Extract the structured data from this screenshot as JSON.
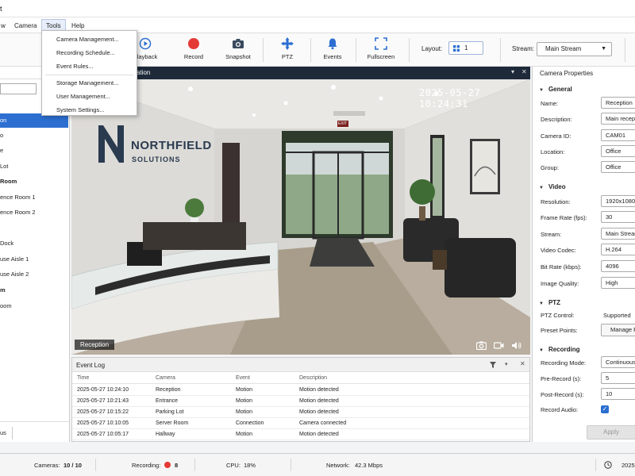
{
  "app": {
    "title_fragment": "t"
  },
  "menu": {
    "items": [
      "w",
      "Camera",
      "Tools",
      "Help"
    ],
    "tools_dropdown": {
      "group1": [
        "Camera Management...",
        "Recording Schedule...",
        "Event Rules..."
      ],
      "group2": [
        "Storage Management...",
        "User Management...",
        "System Settings..."
      ]
    }
  },
  "toolbar": {
    "playback": "Playback",
    "record": "Record",
    "snapshot": "Snapshot",
    "ptz": "PTZ",
    "events": "Events",
    "fullscreen": "Fullscreen",
    "layout_label": "Layout:",
    "layout_value": "1",
    "stream_label": "Stream:",
    "stream_value": "Main Stream"
  },
  "left_panel": {
    "header": "▾",
    "bottom_tab": "us",
    "tree": [
      {
        "label": "on",
        "type": "camera",
        "selected": true
      },
      {
        "label": "o",
        "type": "camera"
      },
      {
        "label": "e",
        "type": "camera"
      },
      {
        "label": " Lot",
        "type": "camera"
      },
      {
        "label": " Room",
        "type": "group"
      },
      {
        "label": "ence Room 1",
        "type": "camera"
      },
      {
        "label": "ence Room 2",
        "type": "camera"
      },
      {
        "label": "",
        "type": "group"
      },
      {
        "label": " Dock",
        "type": "camera"
      },
      {
        "label": "use Aisle 1",
        "type": "camera"
      },
      {
        "label": "use Aisle 2",
        "type": "camera"
      },
      {
        "label": "m",
        "type": "group"
      },
      {
        "label": "oom",
        "type": "camera"
      }
    ]
  },
  "video": {
    "header_title": "ation",
    "timestamp": "2025-05-27 10:24:31",
    "camera_label": "Reception",
    "logo_line1": "NORTHFIELD",
    "logo_line2": "SOLUTIONS",
    "exit_sign": "EXIT"
  },
  "event_log": {
    "title": "Event Log",
    "columns": [
      "Time",
      "Camera",
      "Event",
      "Description"
    ],
    "rows": [
      [
        "2025-05-27 10:24:10",
        "Reception",
        "Motion",
        "Motion detected"
      ],
      [
        "2025-05-27 10:21:43",
        "Entrance",
        "Motion",
        "Motion detected"
      ],
      [
        "2025-05-27 10:15:22",
        "Parking Lot",
        "Motion",
        "Motion detected"
      ],
      [
        "2025-05-27 10:10:05",
        "Server Room",
        "Connection",
        "Camera connected"
      ],
      [
        "2025-05-27 10:05:17",
        "Hallway",
        "Motion",
        "Motion detected"
      ]
    ]
  },
  "properties": {
    "title": "Camera Properties",
    "general": {
      "heading": "General",
      "name_label": "Name:",
      "name_value": "Reception",
      "description_label": "Description:",
      "description_value": "Main reception",
      "camera_id_label": "Camera ID:",
      "camera_id_value": "CAM01",
      "location_label": "Location:",
      "location_value": "Office",
      "group_label": "Group:",
      "group_value": "Office"
    },
    "video": {
      "heading": "Video",
      "resolution_label": "Resolution:",
      "resolution_value": "1920x1080 (",
      "framerate_label": "Frame Rate (fps):",
      "framerate_value": "30",
      "stream_label": "Stream:",
      "stream_value": "Main Stream",
      "codec_label": "Video Codec:",
      "codec_value": "H.264",
      "bitrate_label": "Bit Rate (kbps):",
      "bitrate_value": "4096",
      "quality_label": "Image Quality:",
      "quality_value": "High"
    },
    "ptz": {
      "heading": "PTZ",
      "control_label": "PTZ Control:",
      "control_value": "Supported",
      "preset_label": "Preset Points:",
      "preset_button": "Manage P"
    },
    "recording": {
      "heading": "Recording",
      "mode_label": "Recording Mode:",
      "mode_value": "Continuous",
      "prerecord_label": "Pre-Record (s):",
      "prerecord_value": "5",
      "postrecord_label": "Post-Record (s):",
      "postrecord_value": "10",
      "audio_label": "Record Audio:",
      "audio_checked": true
    },
    "apply": "Apply"
  },
  "statusbar": {
    "cameras_label": "Cameras:",
    "cameras_value": "10 / 10",
    "recording_label": "Recording:",
    "recording_value": "8",
    "cpu_label": "CPU:",
    "cpu_value": "18%",
    "network_label": "Network:",
    "network_value": "42.3 Mbps",
    "clock_value": "2025-"
  },
  "colors": {
    "accent": "#2c6fd1",
    "record_red": "#e53935",
    "video_header": "#1e2a3a"
  }
}
